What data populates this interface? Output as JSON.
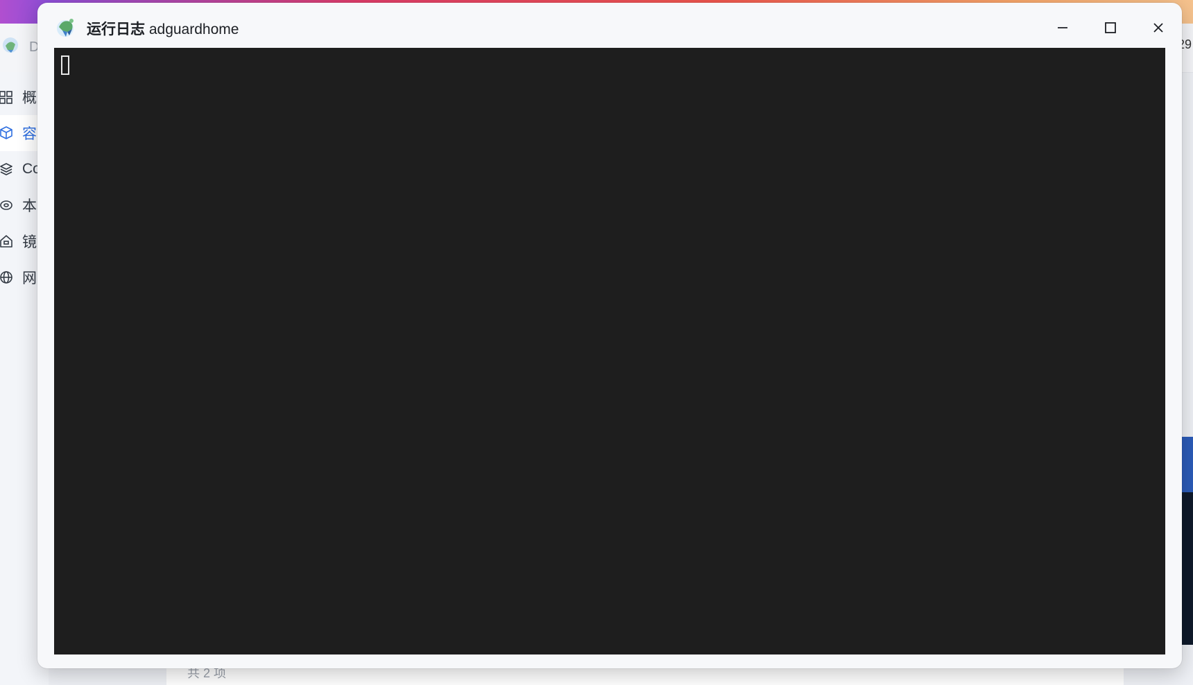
{
  "background_app": {
    "app_name": "D",
    "header_right_text": "29",
    "footer_text": "共 2 项",
    "sidebar": {
      "items": [
        {
          "label": "概",
          "icon": "grid-icon",
          "active": false
        },
        {
          "label": "容",
          "icon": "cube-icon",
          "active": true
        },
        {
          "label": "Co",
          "icon": "layers-icon",
          "active": false
        },
        {
          "label": "本",
          "icon": "disk-icon",
          "active": false
        },
        {
          "label": "镜",
          "icon": "home-icon",
          "active": false
        },
        {
          "label": "网",
          "icon": "globe-icon",
          "active": false
        }
      ]
    }
  },
  "modal": {
    "title_prefix": "运行日志",
    "title_name": "adguardhome",
    "app_icon": "adguard-shield-icon",
    "controls": {
      "minimize": "minimize-icon",
      "maximize": "maximize-icon",
      "close": "close-icon"
    },
    "terminal": {
      "background": "#1e1e1e",
      "cursor_color": "#e8e8e8"
    }
  },
  "colors": {
    "accent": "#2f6fe0",
    "topbar_gradient_start": "#b14fcf",
    "topbar_gradient_end": "#f6c38e"
  }
}
